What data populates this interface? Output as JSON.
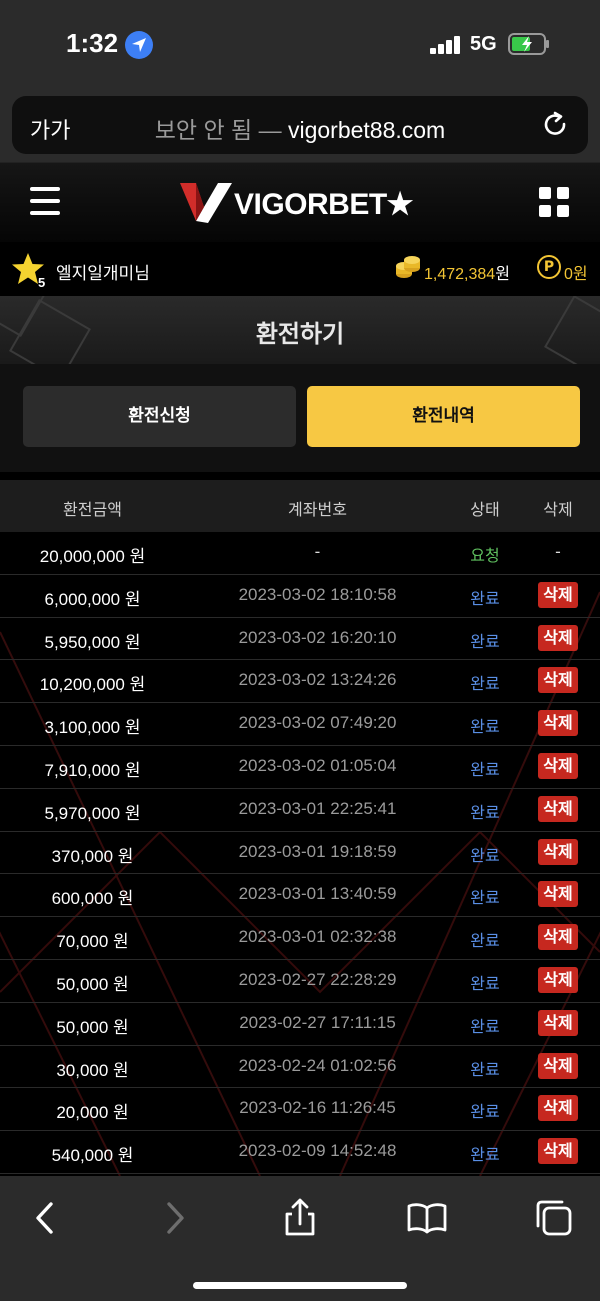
{
  "status_bar": {
    "time": "1:32",
    "network": "5G"
  },
  "browser": {
    "text_size_label": "가가",
    "insecure_label": "보안 안 됨 —",
    "domain": "vigorbet88.com"
  },
  "site": {
    "logo_text": "VIGORBET★"
  },
  "user": {
    "level": "5",
    "username": "엘지일개미님",
    "money": "1,472,384",
    "money_unit": "원",
    "points": "0원"
  },
  "page": {
    "title": "환전하기"
  },
  "tabs": [
    {
      "label": "환전신청",
      "active": false
    },
    {
      "label": "환전내역",
      "active": true
    }
  ],
  "table": {
    "headers": [
      "환전금액",
      "계좌번호",
      "상태",
      "삭제"
    ],
    "rows": [
      {
        "amount": "20,000,000 원",
        "date": "-",
        "status": "요청",
        "delete": "-"
      },
      {
        "amount": "6,000,000 원",
        "date": "2023-03-02 18:10:58",
        "status": "완료",
        "delete": "삭제"
      },
      {
        "amount": "5,950,000 원",
        "date": "2023-03-02 16:20:10",
        "status": "완료",
        "delete": "삭제"
      },
      {
        "amount": "10,200,000 원",
        "date": "2023-03-02 13:24:26",
        "status": "완료",
        "delete": "삭제"
      },
      {
        "amount": "3,100,000 원",
        "date": "2023-03-02 07:49:20",
        "status": "완료",
        "delete": "삭제"
      },
      {
        "amount": "7,910,000 원",
        "date": "2023-03-02 01:05:04",
        "status": "완료",
        "delete": "삭제"
      },
      {
        "amount": "5,970,000 원",
        "date": "2023-03-01 22:25:41",
        "status": "완료",
        "delete": "삭제"
      },
      {
        "amount": "370,000 원",
        "date": "2023-03-01 19:18:59",
        "status": "완료",
        "delete": "삭제"
      },
      {
        "amount": "600,000 원",
        "date": "2023-03-01 13:40:59",
        "status": "완료",
        "delete": "삭제"
      },
      {
        "amount": "70,000 원",
        "date": "2023-03-01 02:32:38",
        "status": "완료",
        "delete": "삭제"
      },
      {
        "amount": "50,000 원",
        "date": "2023-02-27 22:28:29",
        "status": "완료",
        "delete": "삭제"
      },
      {
        "amount": "50,000 원",
        "date": "2023-02-27 17:11:15",
        "status": "완료",
        "delete": "삭제"
      },
      {
        "amount": "30,000 원",
        "date": "2023-02-24 01:02:56",
        "status": "완료",
        "delete": "삭제"
      },
      {
        "amount": "20,000 원",
        "date": "2023-02-16 11:26:45",
        "status": "완료",
        "delete": "삭제"
      },
      {
        "amount": "540,000 원",
        "date": "2023-02-09 14:52:48",
        "status": "완료",
        "delete": "삭제"
      }
    ]
  },
  "colors": {
    "accent": "#f7c843",
    "delete": "#c6281f",
    "status_done": "#5a8fe6",
    "status_pending": "#5fbf5f",
    "gold": "#f3c534"
  },
  "icons": [
    "location-arrow-icon",
    "signal-icon",
    "battery-charging-icon",
    "reload-icon",
    "menu-icon",
    "grid-icon",
    "level-star-icon",
    "coin-stack-icon",
    "point-icon",
    "back-icon",
    "forward-icon",
    "share-icon",
    "bookmarks-icon",
    "tabs-icon"
  ]
}
